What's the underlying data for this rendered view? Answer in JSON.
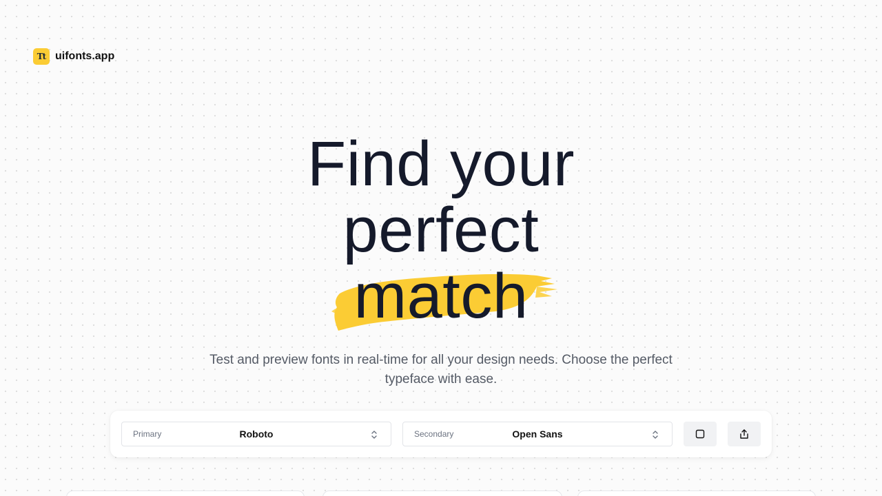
{
  "brand": {
    "logo_mark": "Tt",
    "name": "uifonts.app",
    "accent": "#fbcc34"
  },
  "hero": {
    "line1": "Find your",
    "line2": "perfect",
    "line3": "match",
    "subtitle": "Test and preview fonts in real-time for all your design needs. Choose the perfect typeface with ease."
  },
  "toolbar": {
    "primary": {
      "label": "Primary",
      "value": "Roboto"
    },
    "secondary": {
      "label": "Secondary",
      "value": "Open Sans"
    },
    "square_icon": "square-icon",
    "share_icon": "share-icon"
  }
}
